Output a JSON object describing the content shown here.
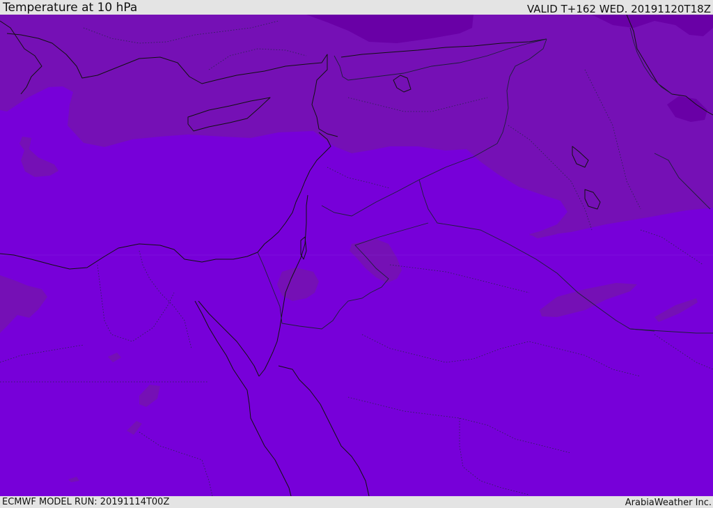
{
  "header": {
    "title": "Temperature at 10 hPa",
    "valid_time": "VALID T+162 WED. 20191120T18Z"
  },
  "footer": {
    "model_run": "ECMWF MODEL RUN: 20191114T00Z",
    "credit": "ArabiaWeather Inc."
  },
  "map": {
    "field": "temperature",
    "level": "10 hPa",
    "region": "Eastern Mediterranean / Middle East",
    "colors": {
      "base_fill": "#7700d9",
      "cooler_band": "#7510b5",
      "coldest_core": "#6900a6",
      "coast_lines": "#111111",
      "border_lines": "#1e1e3a"
    }
  }
}
